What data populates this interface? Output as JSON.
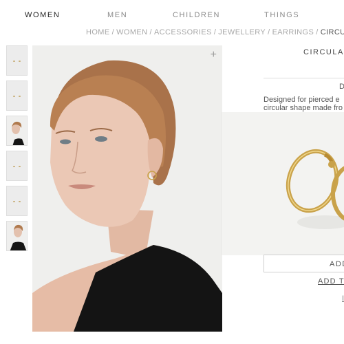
{
  "nav": {
    "items": [
      {
        "label": "WOMEN"
      },
      {
        "label": "MEN"
      },
      {
        "label": "CHILDREN"
      },
      {
        "label": "THINGS"
      }
    ]
  },
  "breadcrumb": {
    "items": [
      "HOME",
      "WOMEN",
      "ACCESSORIES",
      "JEWELLERY",
      "EARRINGS",
      "CIRCULAR"
    ],
    "separator": "/"
  },
  "product": {
    "title": "CIRCULAR",
    "desc_heading": "D",
    "desc_line1": "Designed for pierced e",
    "desc_line2": "circular shape made fro",
    "add_button_label": "ADD",
    "add_link_label": "ADD TO",
    "small_link_label": "I"
  },
  "gallery": {
    "zoom_icon": "plus-icon",
    "thumbnails": [
      "earrings-flat",
      "earrings-flat",
      "model-portrait",
      "earrings-flat",
      "earrings-flat",
      "model-portrait"
    ]
  },
  "colors": {
    "gold": "#c9a24a",
    "hair": "#b07a4e",
    "skin": "#e8c5b2",
    "top": "#141414"
  }
}
